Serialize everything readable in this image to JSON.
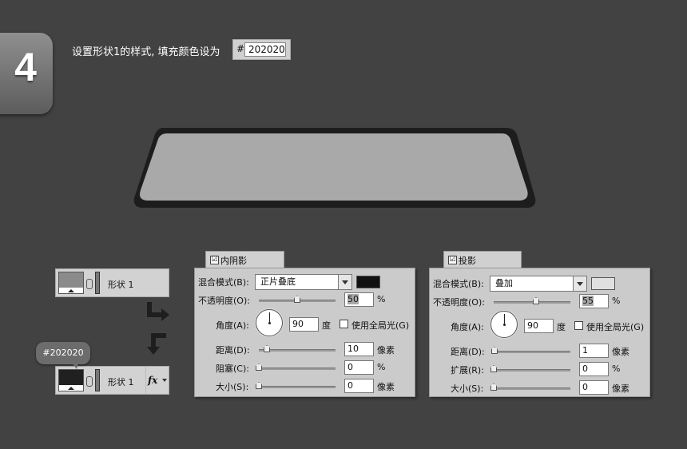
{
  "step": {
    "number": "4"
  },
  "instruction": {
    "text": "设置形状1的样式, 填充颜色设为",
    "hash": "#",
    "hex_value": "202020"
  },
  "layers": {
    "layer_before": {
      "name": "形状 1"
    },
    "layer_after": {
      "name": "形状 1",
      "fx": "fx"
    },
    "tooltip": "#202020"
  },
  "inner_shadow": {
    "tab_label": "内阴影",
    "checked": "☑",
    "blend_mode_label": "混合模式(B):",
    "blend_mode_value": "正片叠底",
    "color": "#111111",
    "opacity_label": "不透明度(O):",
    "opacity_value": "50",
    "opacity_unit": "%",
    "angle_label": "角度(A):",
    "angle_value": "90",
    "angle_unit": "度",
    "global_light_label": "使用全局光(G)",
    "distance_label": "距离(D):",
    "distance_value": "10",
    "distance_unit": "像素",
    "choke_label": "阻塞(C):",
    "choke_value": "0",
    "choke_unit": "%",
    "size_label": "大小(S):",
    "size_value": "0",
    "size_unit": "像素"
  },
  "drop_shadow": {
    "tab_label": "投影",
    "checked": "☑",
    "blend_mode_label": "混合模式(B):",
    "blend_mode_value": "叠加",
    "color": "#e0e0e0",
    "opacity_label": "不透明度(O):",
    "opacity_value": "55",
    "opacity_unit": "%",
    "angle_label": "角度(A):",
    "angle_value": "90",
    "angle_unit": "度",
    "global_light_label": "使用全局光(G)",
    "distance_label": "距离(D):",
    "distance_value": "1",
    "distance_unit": "像素",
    "spread_label": "扩展(R):",
    "spread_value": "0",
    "spread_unit": "%",
    "size_label": "大小(S):",
    "size_value": "0",
    "size_unit": "像素"
  },
  "colors": {
    "background": "#424242",
    "shape_fill": "#a9a9a9",
    "layer_fill": "#202020"
  }
}
